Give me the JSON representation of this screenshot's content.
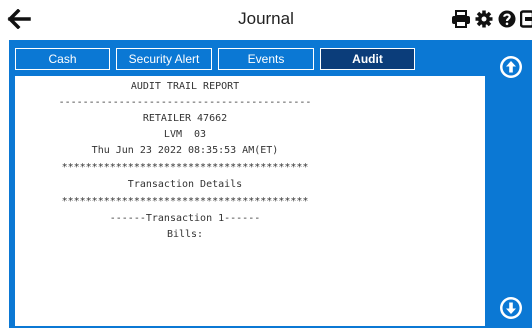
{
  "header": {
    "title": "Journal",
    "back_icon": "arrow-left-icon",
    "icons": [
      "printer-icon",
      "gear-icon",
      "help-icon",
      "exit-icon"
    ]
  },
  "tabs": [
    {
      "label": "Cash",
      "active": false
    },
    {
      "label": "Security Alert",
      "active": false
    },
    {
      "label": "Events",
      "active": false
    },
    {
      "label": "Audit",
      "active": true
    }
  ],
  "report": {
    "lines": [
      "AUDIT TRAIL REPORT",
      "------------------------------------------",
      "RETAILER 47662",
      "LVM  03",
      "Thu Jun 23 2022 08:35:53 AM(ET)",
      "*****************************************",
      "Transaction Details",
      "*****************************************",
      "------Transaction 1------",
      "Bills:"
    ]
  },
  "scroll": {
    "up_icon": "arrow-up-circle-icon",
    "down_icon": "arrow-down-circle-icon"
  },
  "colors": {
    "panel": "#0b78d4",
    "active_tab": "#0b3d7a"
  }
}
